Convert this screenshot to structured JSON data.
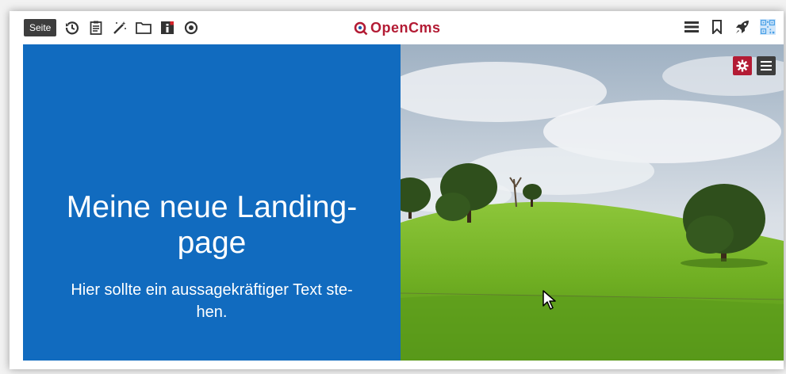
{
  "toolbar": {
    "seite_label": "Seite",
    "left_icons": [
      "history-icon",
      "clipboard-icon",
      "magic-wand-icon",
      "folder-icon",
      "info-icon",
      "target-icon"
    ],
    "logo_text": "OpenCms",
    "right_icons": [
      "menu-icon",
      "bookmark-icon",
      "rocket-icon",
      "qr-icon"
    ]
  },
  "hero": {
    "title": "Meine neue Landing-page",
    "title_line1": "Meine neue Landing-",
    "title_line2": "page",
    "subtitle_line1": "Hier sollte ein aussagekräftiger Text ste-",
    "subtitle_line2": "hen.",
    "image_description": "landscape-photo",
    "edit_buttons": [
      "gear-icon",
      "menu-icon"
    ]
  },
  "colors": {
    "accent": "#b31b34",
    "hero_blue": "#116bbf",
    "toolbar_dark": "#3d3d3d"
  }
}
